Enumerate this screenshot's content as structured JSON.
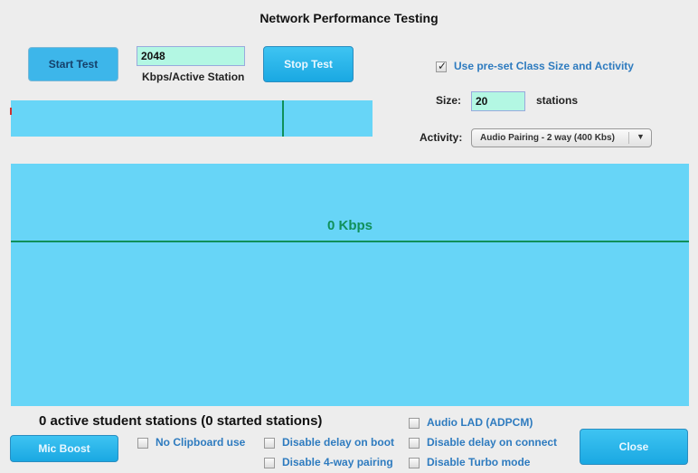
{
  "window": {
    "title": "Network Performance Testing"
  },
  "controls": {
    "start_label": "Start Test",
    "stop_label": "Stop Test",
    "kbps_value": "2048",
    "kbps_label": "Kbps/Active Station"
  },
  "preset": {
    "checkbox_label": "Use pre-set Class Size and Activity",
    "checked": true,
    "size_label": "Size:",
    "size_value": "20",
    "size_unit": "stations",
    "activity_label": "Activity:",
    "activity_value": "Audio Pairing - 2 way (400 Kbs)"
  },
  "graph": {
    "throughput_label": "0 Kbps",
    "line_color": "#10905a",
    "background": "#67d5f7"
  },
  "status": {
    "text": "0 active student stations (0 started stations)"
  },
  "options": {
    "mic_boost_label": "Mic Boost",
    "close_label": "Close",
    "checkboxes": [
      {
        "label": "No Clipboard use",
        "checked": false
      },
      {
        "label": "Disable delay on boot",
        "checked": false
      },
      {
        "label": "Disable 4-way pairing",
        "checked": false
      },
      {
        "label": "Audio LAD (ADPCM)",
        "checked": false
      },
      {
        "label": "Disable delay on connect",
        "checked": false
      },
      {
        "label": "Disable Turbo mode",
        "checked": false
      }
    ]
  }
}
